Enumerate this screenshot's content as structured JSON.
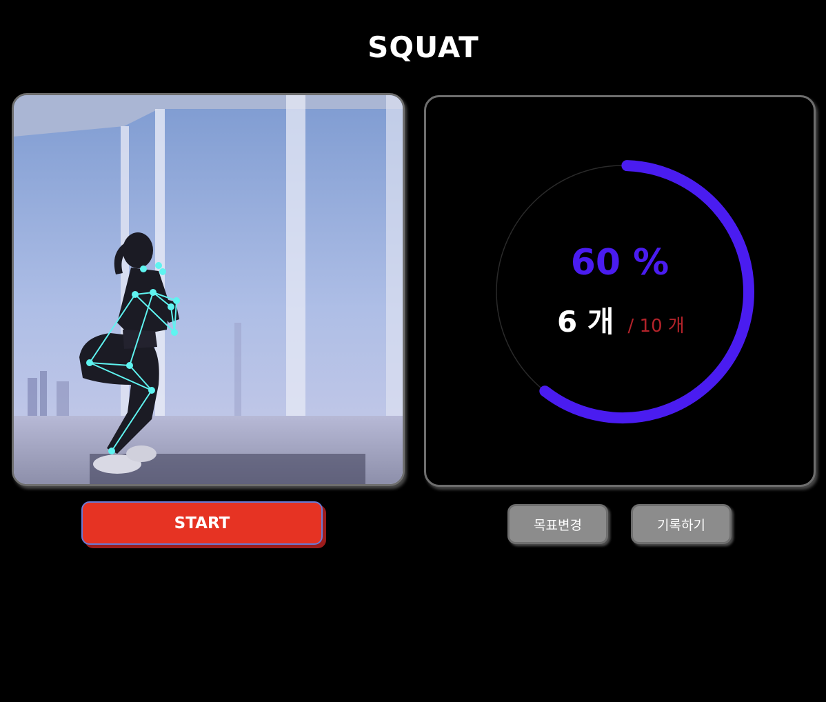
{
  "title": "SQUAT",
  "progress": {
    "percent_label": "60 %",
    "count_label": "6 개",
    "goal_label": "/ 10 개",
    "fraction": 0.6,
    "ring_color": "#4a1cf0"
  },
  "buttons": {
    "start": "START",
    "change_goal": "목표변경",
    "record": "기록하기"
  },
  "colors": {
    "start_button": "#e63323",
    "secondary_button": "#8c8c8c",
    "pose_skeleton": "#5ff3f0"
  }
}
